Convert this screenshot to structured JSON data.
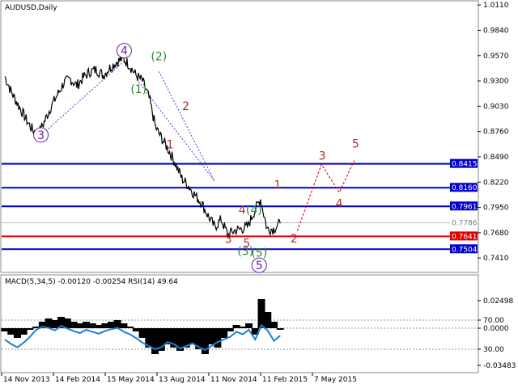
{
  "main_title": "AUDUSD,Daily",
  "indicator_title": "MACD(5,34,5) -0.00120 -0.00254 RSI(14) 49.64",
  "colors": {
    "price": "#000000",
    "support_line": "#0000cc",
    "key_level_line": "#dd0000",
    "current_price_line": "#bbbbbb",
    "wave_primary": "#6a1fa0",
    "wave_intermediate": "#2a8a2a",
    "wave_minor": "#a83232",
    "projection": "#cc0000",
    "rsi_line": "#1e7fd6",
    "histogram": "#000000"
  },
  "chart_data": [
    {
      "type": "line",
      "title": "AUDUSD,Daily",
      "x_dates": [
        "14 Nov 2013",
        "14 Feb 2014",
        "15 May 2014",
        "13 Aug 2014",
        "11 Nov 2014",
        "11 Feb 2015",
        "7 May 2015"
      ],
      "y_ticks": [
        "1.0110",
        "0.9840",
        "0.9570",
        "0.9300",
        "0.9030",
        "0.8760",
        "0.8490",
        "0.8220",
        "0.7950",
        "0.7680",
        "0.7410"
      ],
      "ylim": [
        0.7265,
        1.0146
      ],
      "series": [
        {
          "values": [
            0.935,
            0.918,
            0.905,
            0.892,
            0.88,
            0.872,
            0.886,
            0.902,
            0.915,
            0.928,
            0.932,
            0.925,
            0.934,
            0.94,
            0.942,
            0.936,
            0.944,
            0.95,
            0.954,
            0.947,
            0.936,
            0.93,
            0.912,
            0.88,
            0.868,
            0.856,
            0.842,
            0.826,
            0.818,
            0.808,
            0.8,
            0.786,
            0.774,
            0.782,
            0.766,
            0.77,
            0.772,
            0.774,
            0.79,
            0.804,
            0.772,
            0.772,
            0.778
          ]
        }
      ],
      "horizontal_levels": [
        {
          "value": 0.8415,
          "label": "0.8415",
          "kind": "support"
        },
        {
          "value": 0.816,
          "label": "0.8160",
          "kind": "support"
        },
        {
          "value": 0.7961,
          "label": "0.7961",
          "kind": "support"
        },
        {
          "value": 0.7641,
          "label": "0.7641",
          "kind": "key"
        },
        {
          "value": 0.7504,
          "label": "0.7504",
          "kind": "support"
        },
        {
          "value": 0.7786,
          "label": "0.7786",
          "kind": "current"
        }
      ],
      "annotations": [
        {
          "text": "3",
          "x_index": 5.5,
          "y": 0.868,
          "style": "primary-circle"
        },
        {
          "text": "4",
          "x_index": 18.2,
          "y": 0.958,
          "style": "primary-circle"
        },
        {
          "text": "5",
          "x_index": 38.8,
          "y": 0.729,
          "style": "primary-circle"
        },
        {
          "text": "(1)",
          "x_index": 20.4,
          "y": 0.917,
          "style": "intermediate"
        },
        {
          "text": "(2)",
          "x_index": 23.5,
          "y": 0.952,
          "style": "intermediate"
        },
        {
          "text": "(3)",
          "x_index": 36.7,
          "y": 0.744,
          "style": "intermediate"
        },
        {
          "text": "(4)",
          "x_index": 38.0,
          "y": 0.788,
          "style": "intermediate"
        },
        {
          "text": "(5)",
          "x_index": 38.8,
          "y": 0.7425,
          "style": "intermediate"
        },
        {
          "text": "1",
          "x_index": 25.2,
          "y": 0.858,
          "style": "minor"
        },
        {
          "text": "2",
          "x_index": 27.6,
          "y": 0.899,
          "style": "minor"
        },
        {
          "text": "3",
          "x_index": 34.1,
          "y": 0.757,
          "style": "minor"
        },
        {
          "text": "4",
          "x_index": 36.2,
          "y": 0.788,
          "style": "minor"
        },
        {
          "text": "5",
          "x_index": 36.9,
          "y": 0.753,
          "style": "minor"
        },
        {
          "text": "1",
          "x_index": 41.6,
          "y": 0.815,
          "style": "minor"
        },
        {
          "text": "2",
          "x_index": 44.1,
          "y": 0.7575,
          "style": "minor"
        },
        {
          "text": "3",
          "x_index": 48.4,
          "y": 0.846,
          "style": "minor"
        },
        {
          "text": "4",
          "x_index": 51.0,
          "y": 0.795,
          "style": "minor"
        },
        {
          "text": "5",
          "x_index": 53.5,
          "y": 0.859,
          "style": "minor"
        }
      ],
      "projection_path": [
        {
          "x_index": 44.6,
          "y": 0.77
        },
        {
          "x_index": 48.3,
          "y": 0.841
        },
        {
          "x_index": 51.0,
          "y": 0.811
        },
        {
          "x_index": 53.3,
          "y": 0.845
        }
      ],
      "guide_lines": [
        {
          "from": {
            "x_index": 5.5,
            "y": 0.872
          },
          "to": {
            "x_index": 18.2,
            "y": 0.951
          }
        },
        {
          "from": {
            "x_index": 20.4,
            "y": 0.929
          },
          "to": {
            "x_index": 32.0,
            "y": 0.823
          }
        },
        {
          "from": {
            "x_index": 23.5,
            "y": 0.94
          },
          "to": {
            "x_index": 32.0,
            "y": 0.823
          }
        }
      ]
    },
    {
      "type": "bar",
      "title": "MACD(5,34,5) -0.00120 -0.00254 RSI(14) 49.64",
      "y_ticks": [
        "0.02498",
        "70.00",
        "0.0000",
        "30.00",
        "-0.03483"
      ],
      "ylim": [
        -0.03483,
        0.02498
      ],
      "histogram": [
        -0.002,
        -0.004,
        -0.006,
        -0.004,
        -0.001,
        0.001,
        0.004,
        0.006,
        0.005,
        0.007,
        0.006,
        0.004,
        0.003,
        0.004,
        0.003,
        0.002,
        0.003,
        0.004,
        0.005,
        0.003,
        0.001,
        -0.002,
        -0.006,
        -0.012,
        -0.016,
        -0.014,
        -0.01,
        -0.012,
        -0.014,
        -0.012,
        -0.01,
        -0.013,
        -0.016,
        -0.01,
        -0.012,
        -0.006,
        -0.002,
        0.002,
        0.001,
        0.003,
        -0.004,
        0.018,
        0.01,
        0.004,
        -0.001
      ],
      "rsi": [
        40,
        33,
        28,
        35,
        44,
        55,
        60,
        58,
        54,
        61,
        57,
        53,
        50,
        55,
        52,
        49,
        53,
        56,
        58,
        52,
        48,
        42,
        35,
        30,
        25,
        28,
        36,
        33,
        26,
        30,
        34,
        28,
        24,
        30,
        36,
        40,
        44,
        52,
        48,
        55,
        40,
        62,
        54,
        38,
        46
      ]
    }
  ]
}
